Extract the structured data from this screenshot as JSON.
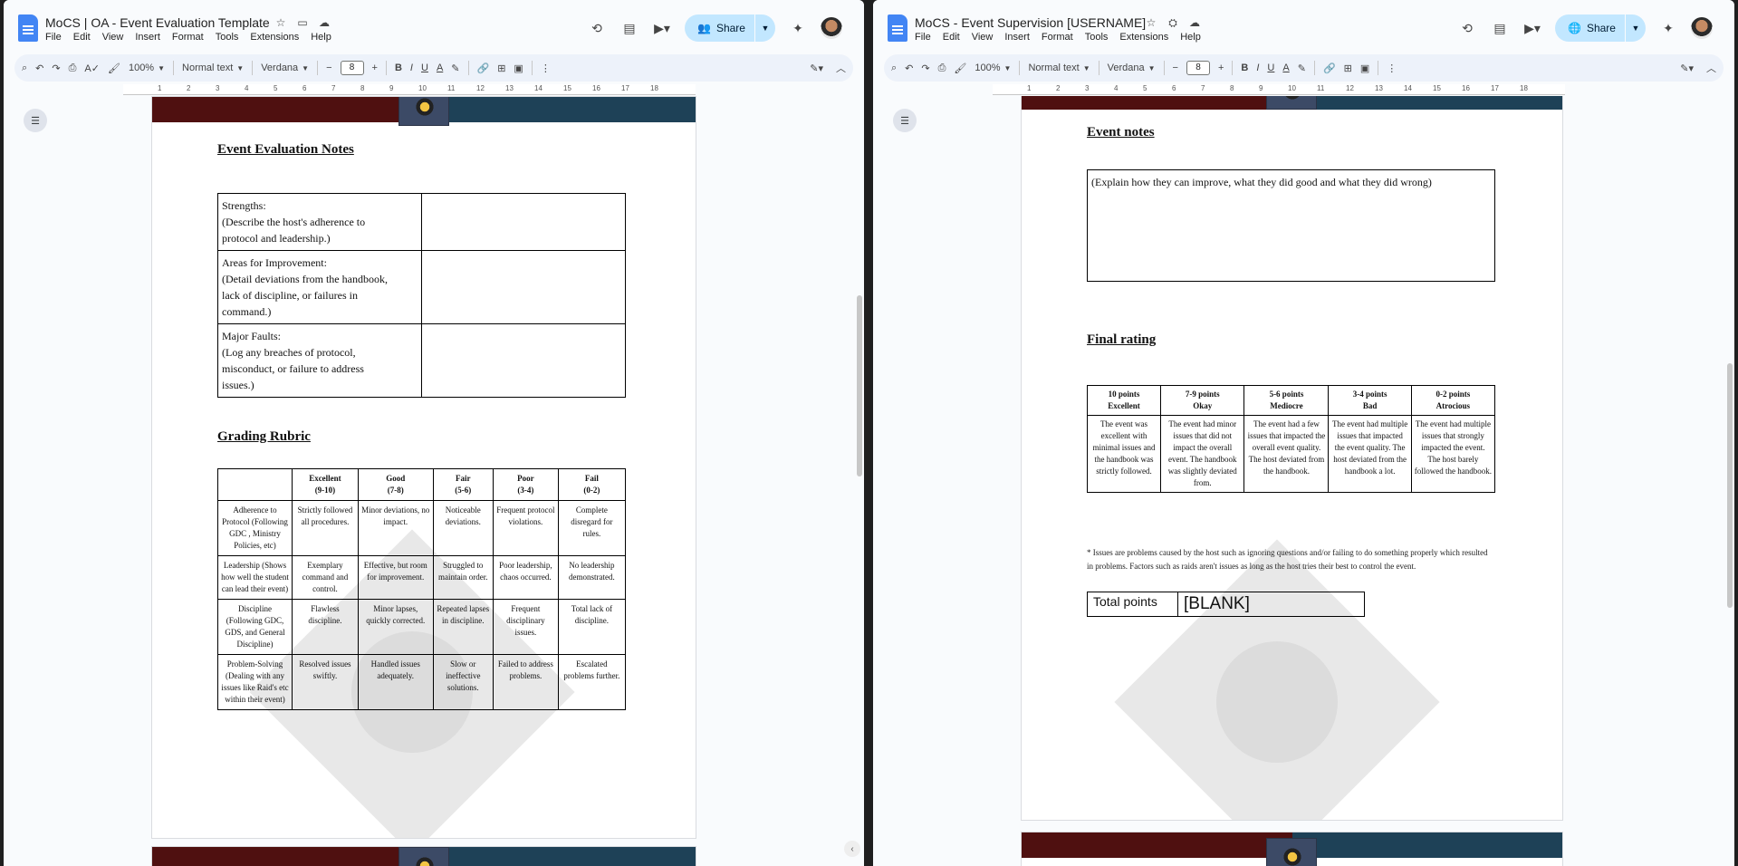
{
  "left": {
    "title": "MoCS | OA - Event Evaluation Template",
    "menu": [
      "File",
      "Edit",
      "View",
      "Insert",
      "Format",
      "Tools",
      "Extensions",
      "Help"
    ],
    "share_label": "Share",
    "toolbar": {
      "zoom": "100%",
      "style": "Normal text",
      "font": "Verdana",
      "font_size": "8"
    },
    "ruler_numbers": [
      "1",
      "2",
      "3",
      "4",
      "5",
      "6",
      "7",
      "8",
      "9",
      "10",
      "11",
      "12",
      "13",
      "14",
      "15",
      "16",
      "17",
      "18"
    ],
    "heading": "Event Evaluation Notes",
    "notes": [
      {
        "lines": [
          "Strengths:",
          "(Describe the host's adherence to",
          "protocol and leadership.)"
        ],
        "value": ""
      },
      {
        "lines": [
          "Areas for Improvement:",
          "(Detail deviations from the handbook,",
          "lack of discipline, or failures in",
          "command.)"
        ],
        "value": ""
      },
      {
        "lines": [
          "Major Faults:",
          "(Log any breaches of protocol,",
          "misconduct, or failure to address",
          "issues.)"
        ],
        "value": ""
      }
    ],
    "rubric_heading": "Grading Rubric",
    "rubric_header": [
      {
        "name": "Excellent",
        "range": "(9-10)"
      },
      {
        "name": "Good",
        "range": "(7-8)"
      },
      {
        "name": "Fair",
        "range": "(5-6)"
      },
      {
        "name": "Poor",
        "range": "(3-4)"
      },
      {
        "name": "Fail",
        "range": "(0-2)"
      }
    ],
    "rubric_rows": [
      {
        "criterion": "Adherence to Protocol (Following GDC , Ministry Policies, etc)",
        "cells": [
          "Strictly followed all procedures.",
          "Minor deviations, no impact.",
          "Noticeable deviations.",
          "Frequent protocol violations.",
          "Complete disregard for rules."
        ]
      },
      {
        "criterion": "Leadership (Shows how well the student can lead their event)",
        "cells": [
          "Exemplary command and control.",
          "Effective, but room for improvement.",
          "Struggled to maintain order.",
          "Poor leadership, chaos occurred.",
          "No leadership demonstrated."
        ]
      },
      {
        "criterion": "Discipline (Following GDC, GDS, and General Discipline)",
        "cells": [
          "Flawless discipline.",
          "Minor lapses, quickly corrected.",
          "Repeated lapses in discipline.",
          "Frequent disciplinary issues.",
          "Total lack of discipline."
        ]
      },
      {
        "criterion": "Problem-Solving (Dealing with any issues like Raid's etc within their event)",
        "cells": [
          "Resolved issues swiftly.",
          "Handled issues adequately.",
          "Slow or ineffective solutions.",
          "Failed to address problems.",
          "Escalated problems further."
        ]
      }
    ]
  },
  "right": {
    "title": "MoCS - Event Supervision [USERNAME]",
    "menu": [
      "File",
      "Edit",
      "View",
      "Insert",
      "Format",
      "Tools",
      "Extensions",
      "Help"
    ],
    "share_label": "Share",
    "toolbar": {
      "zoom": "100%",
      "style": "Normal text",
      "font": "Verdana",
      "font_size": "8"
    },
    "ruler_numbers": [
      "1",
      "2",
      "3",
      "4",
      "5",
      "6",
      "7",
      "8",
      "9",
      "10",
      "11",
      "12",
      "13",
      "14",
      "15",
      "16",
      "17",
      "18"
    ],
    "event_notes_heading": "Event notes",
    "event_notes_text": "(Explain how they can improve, what they did good and what they did wrong)",
    "final_rating_heading": "Final rating",
    "rating_header": [
      {
        "points": "10 points",
        "label": "Excellent"
      },
      {
        "points": "7-9 points",
        "label": "Okay"
      },
      {
        "points": "5-6 points",
        "label": "Mediocre"
      },
      {
        "points": "3-4 points",
        "label": "Bad"
      },
      {
        "points": "0-2 points",
        "label": "Atrocious"
      }
    ],
    "rating_desc": [
      "The event was excellent with minimal issues and the handbook was strictly followed.",
      "The event had minor issues that did not impact the overall event. The handbook was slightly deviated from.",
      "The event had a few issues that impacted the overall event quality. The host deviated from the handbook.",
      "The event had multiple issues that impacted the event quality. The host deviated from the handbook a lot.",
      "The event had multiple issues that strongly impacted the event. The host barely followed the handbook."
    ],
    "footnote": "* Issues are problems caused by the host such as ignoring questions and/or failing to do something properly which resulted in problems. Factors such as raids aren't issues as long as the host tries their best to control the event.",
    "total_label": "Total points",
    "total_value": "[BLANK]"
  }
}
